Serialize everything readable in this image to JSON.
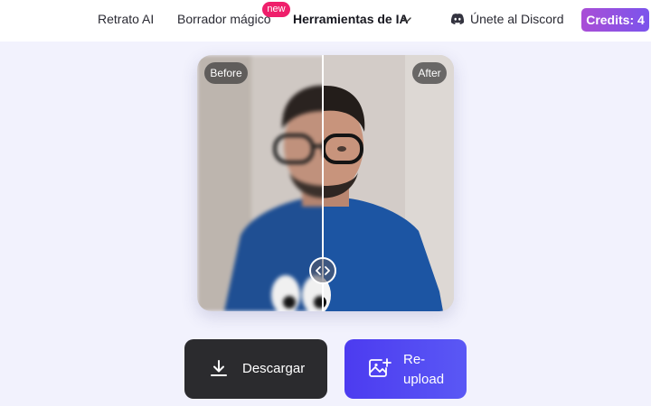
{
  "nav": {
    "links": [
      "Retrato AI",
      "Borrador mágico",
      "Herramientas de IA"
    ],
    "new_badge": "new",
    "discord": "Únete al Discord",
    "credits": "Credits: 4"
  },
  "compare": {
    "before_label": "Before",
    "after_label": "After",
    "slider_fraction": 0.49
  },
  "actions": {
    "download": "Descargar",
    "reupload_line1": "Re-",
    "reupload_line2": "upload"
  },
  "icons": {
    "tools_chevron": "chevron-down-icon",
    "discord": "discord-icon",
    "handle": "compare-arrows-icon",
    "download": "download-icon",
    "reupload": "image-plus-icon"
  }
}
